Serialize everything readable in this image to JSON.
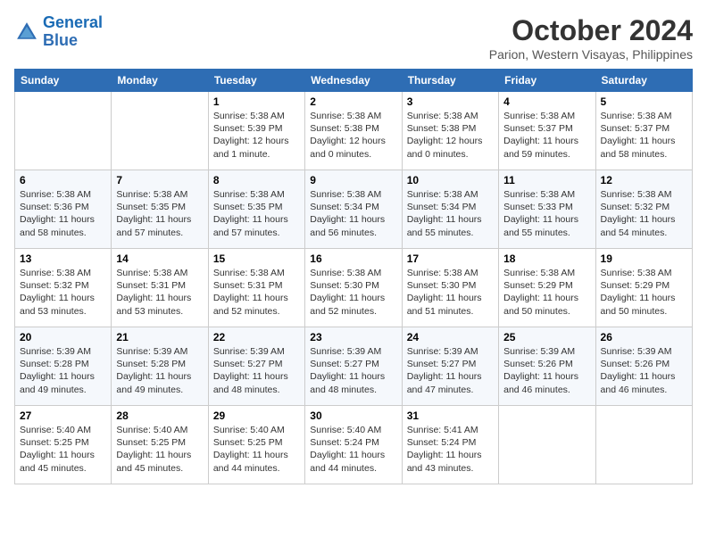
{
  "header": {
    "logo_line1": "General",
    "logo_line2": "Blue",
    "month": "October 2024",
    "location": "Parion, Western Visayas, Philippines"
  },
  "weekdays": [
    "Sunday",
    "Monday",
    "Tuesday",
    "Wednesday",
    "Thursday",
    "Friday",
    "Saturday"
  ],
  "weeks": [
    [
      {
        "day": "",
        "info": ""
      },
      {
        "day": "",
        "info": ""
      },
      {
        "day": "1",
        "info": "Sunrise: 5:38 AM\nSunset: 5:39 PM\nDaylight: 12 hours\nand 1 minute."
      },
      {
        "day": "2",
        "info": "Sunrise: 5:38 AM\nSunset: 5:38 PM\nDaylight: 12 hours\nand 0 minutes."
      },
      {
        "day": "3",
        "info": "Sunrise: 5:38 AM\nSunset: 5:38 PM\nDaylight: 12 hours\nand 0 minutes."
      },
      {
        "day": "4",
        "info": "Sunrise: 5:38 AM\nSunset: 5:37 PM\nDaylight: 11 hours\nand 59 minutes."
      },
      {
        "day": "5",
        "info": "Sunrise: 5:38 AM\nSunset: 5:37 PM\nDaylight: 11 hours\nand 58 minutes."
      }
    ],
    [
      {
        "day": "6",
        "info": "Sunrise: 5:38 AM\nSunset: 5:36 PM\nDaylight: 11 hours\nand 58 minutes."
      },
      {
        "day": "7",
        "info": "Sunrise: 5:38 AM\nSunset: 5:35 PM\nDaylight: 11 hours\nand 57 minutes."
      },
      {
        "day": "8",
        "info": "Sunrise: 5:38 AM\nSunset: 5:35 PM\nDaylight: 11 hours\nand 57 minutes."
      },
      {
        "day": "9",
        "info": "Sunrise: 5:38 AM\nSunset: 5:34 PM\nDaylight: 11 hours\nand 56 minutes."
      },
      {
        "day": "10",
        "info": "Sunrise: 5:38 AM\nSunset: 5:34 PM\nDaylight: 11 hours\nand 55 minutes."
      },
      {
        "day": "11",
        "info": "Sunrise: 5:38 AM\nSunset: 5:33 PM\nDaylight: 11 hours\nand 55 minutes."
      },
      {
        "day": "12",
        "info": "Sunrise: 5:38 AM\nSunset: 5:32 PM\nDaylight: 11 hours\nand 54 minutes."
      }
    ],
    [
      {
        "day": "13",
        "info": "Sunrise: 5:38 AM\nSunset: 5:32 PM\nDaylight: 11 hours\nand 53 minutes."
      },
      {
        "day": "14",
        "info": "Sunrise: 5:38 AM\nSunset: 5:31 PM\nDaylight: 11 hours\nand 53 minutes."
      },
      {
        "day": "15",
        "info": "Sunrise: 5:38 AM\nSunset: 5:31 PM\nDaylight: 11 hours\nand 52 minutes."
      },
      {
        "day": "16",
        "info": "Sunrise: 5:38 AM\nSunset: 5:30 PM\nDaylight: 11 hours\nand 52 minutes."
      },
      {
        "day": "17",
        "info": "Sunrise: 5:38 AM\nSunset: 5:30 PM\nDaylight: 11 hours\nand 51 minutes."
      },
      {
        "day": "18",
        "info": "Sunrise: 5:38 AM\nSunset: 5:29 PM\nDaylight: 11 hours\nand 50 minutes."
      },
      {
        "day": "19",
        "info": "Sunrise: 5:38 AM\nSunset: 5:29 PM\nDaylight: 11 hours\nand 50 minutes."
      }
    ],
    [
      {
        "day": "20",
        "info": "Sunrise: 5:39 AM\nSunset: 5:28 PM\nDaylight: 11 hours\nand 49 minutes."
      },
      {
        "day": "21",
        "info": "Sunrise: 5:39 AM\nSunset: 5:28 PM\nDaylight: 11 hours\nand 49 minutes."
      },
      {
        "day": "22",
        "info": "Sunrise: 5:39 AM\nSunset: 5:27 PM\nDaylight: 11 hours\nand 48 minutes."
      },
      {
        "day": "23",
        "info": "Sunrise: 5:39 AM\nSunset: 5:27 PM\nDaylight: 11 hours\nand 48 minutes."
      },
      {
        "day": "24",
        "info": "Sunrise: 5:39 AM\nSunset: 5:27 PM\nDaylight: 11 hours\nand 47 minutes."
      },
      {
        "day": "25",
        "info": "Sunrise: 5:39 AM\nSunset: 5:26 PM\nDaylight: 11 hours\nand 46 minutes."
      },
      {
        "day": "26",
        "info": "Sunrise: 5:39 AM\nSunset: 5:26 PM\nDaylight: 11 hours\nand 46 minutes."
      }
    ],
    [
      {
        "day": "27",
        "info": "Sunrise: 5:40 AM\nSunset: 5:25 PM\nDaylight: 11 hours\nand 45 minutes."
      },
      {
        "day": "28",
        "info": "Sunrise: 5:40 AM\nSunset: 5:25 PM\nDaylight: 11 hours\nand 45 minutes."
      },
      {
        "day": "29",
        "info": "Sunrise: 5:40 AM\nSunset: 5:25 PM\nDaylight: 11 hours\nand 44 minutes."
      },
      {
        "day": "30",
        "info": "Sunrise: 5:40 AM\nSunset: 5:24 PM\nDaylight: 11 hours\nand 44 minutes."
      },
      {
        "day": "31",
        "info": "Sunrise: 5:41 AM\nSunset: 5:24 PM\nDaylight: 11 hours\nand 43 minutes."
      },
      {
        "day": "",
        "info": ""
      },
      {
        "day": "",
        "info": ""
      }
    ]
  ]
}
